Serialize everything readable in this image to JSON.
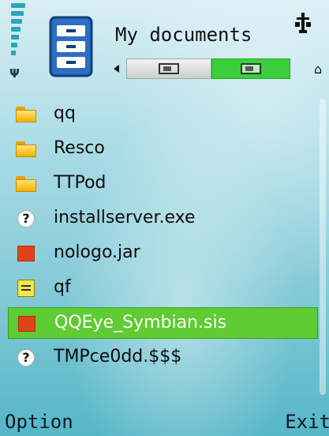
{
  "header": {
    "title": "My documents",
    "tabs": [
      {
        "name": "phone-memory",
        "active": false
      },
      {
        "name": "memory-card",
        "active": true
      }
    ]
  },
  "files": [
    {
      "name": "qq",
      "type": "folder"
    },
    {
      "name": "Resco",
      "type": "folder"
    },
    {
      "name": "TTPod",
      "type": "folder"
    },
    {
      "name": "installserver.exe",
      "type": "unknown"
    },
    {
      "name": "nologo.jar",
      "type": "application"
    },
    {
      "name": "qf",
      "type": "note"
    },
    {
      "name": "QQEye_Symbian.sis",
      "type": "application",
      "selected": true
    },
    {
      "name": "TMPce0dd.$$$",
      "type": "unknown"
    }
  ],
  "unknown_glyph": "?",
  "softkeys": {
    "left": "Option",
    "right": "Exit"
  },
  "colors": {
    "selection": "#5fcc33",
    "active_tab": "#3ccf3c",
    "folder": "#f0b000",
    "app_icon": "#e2421a"
  }
}
